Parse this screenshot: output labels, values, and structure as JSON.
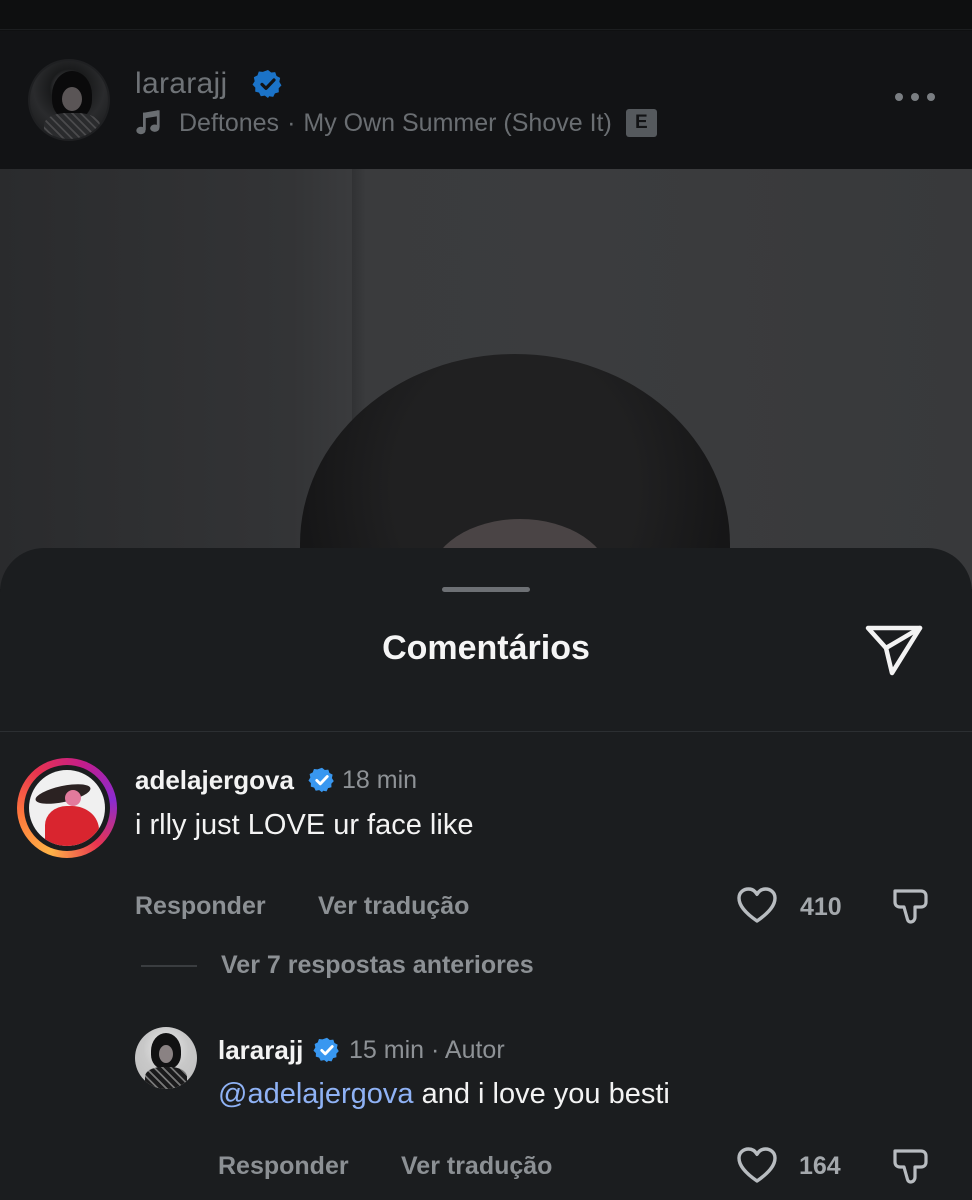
{
  "post": {
    "username": "lararajj",
    "music": {
      "artist": "Deftones",
      "separator": "·",
      "track": "My Own Summer (Shove It)",
      "explicit_badge": "E"
    },
    "icons": {
      "verified": "verified-badge-icon",
      "music": "music-note-icon",
      "more": "more-options-icon"
    }
  },
  "comments_sheet": {
    "title": "Comentários",
    "share_icon": "send-icon",
    "comments": [
      {
        "username": "adelajergova",
        "verified": true,
        "time": "18 min",
        "text": "i rlly just LOVE ur face like",
        "reply_label": "Responder",
        "translate_label": "Ver tradução",
        "likes": "410"
      }
    ],
    "view_replies_label": "Ver 7 respostas anteriores",
    "replies": [
      {
        "username": "lararajj",
        "verified": true,
        "time": "15 min",
        "author_separator": "·",
        "author_label": "Autor",
        "mention": "@adelajergova",
        "text": " and i love you besti",
        "reply_label": "Responder",
        "translate_label": "Ver tradução",
        "likes": "164"
      }
    ]
  },
  "colors": {
    "background": "#0f1011",
    "sheet": "#1b1d1f",
    "verified_blue": "#3897f0",
    "mention": "#8fb2f5",
    "secondary_text": "#8c9094"
  }
}
